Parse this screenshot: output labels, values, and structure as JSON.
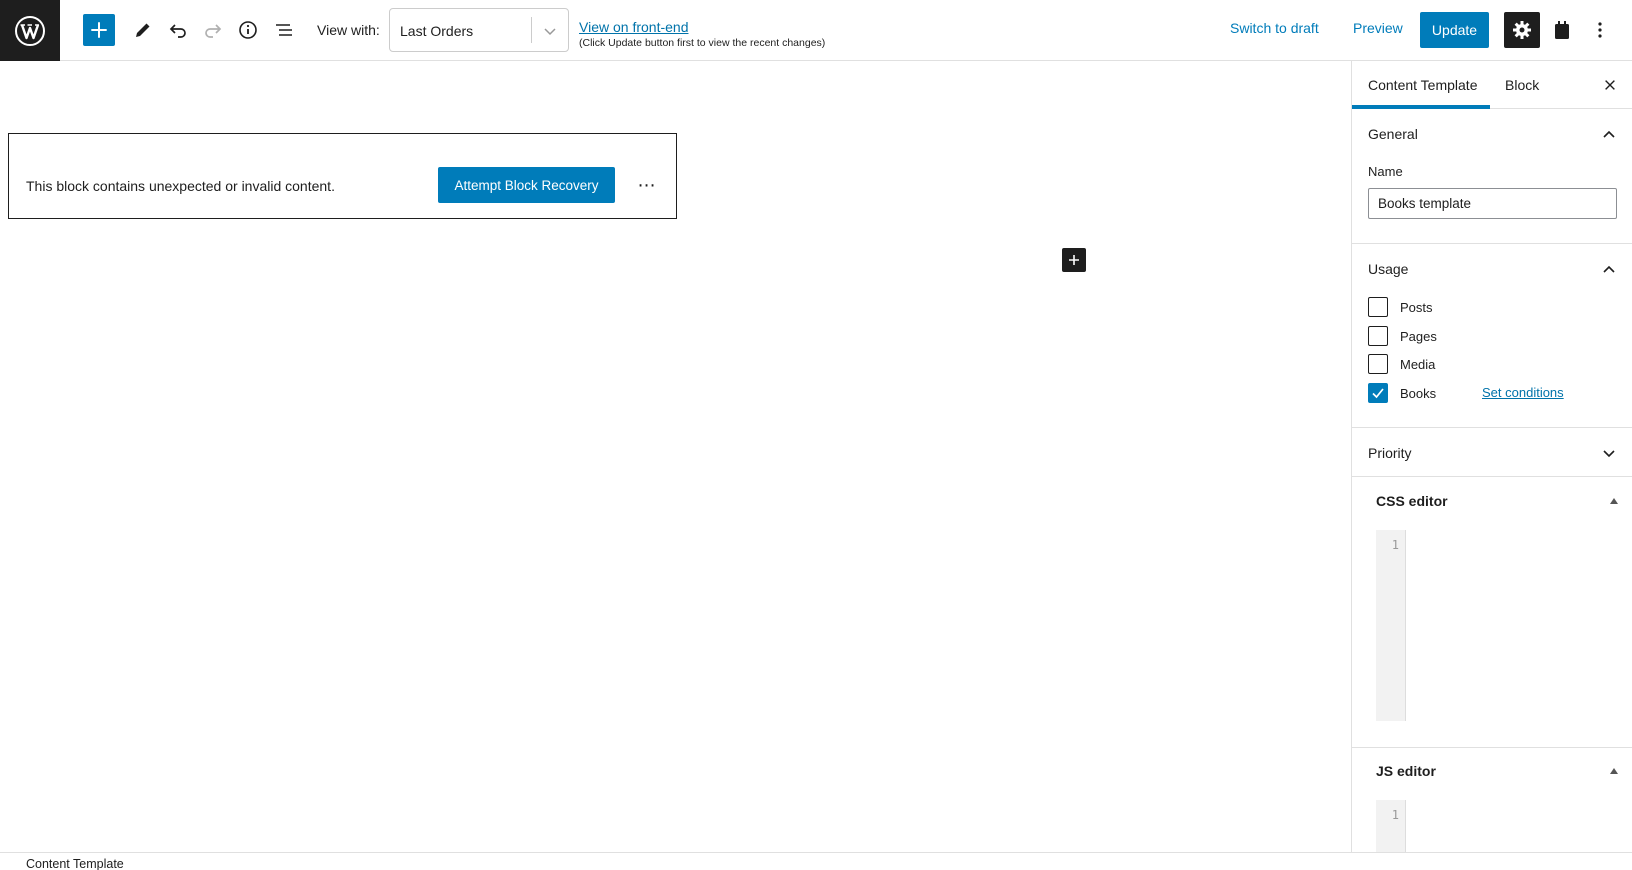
{
  "toolbar": {
    "view_with_label": "View with:",
    "view_with_value": "Last Orders",
    "frontend_link": "View on front-end",
    "frontend_note": "(Click Update button first to view the recent changes)",
    "switch_to_draft": "Switch to draft",
    "preview": "Preview",
    "update": "Update"
  },
  "editor": {
    "warning_text": "This block contains unexpected or invalid content.",
    "recovery_button": "Attempt Block Recovery",
    "more_label": "⋯"
  },
  "sidebar": {
    "tabs": [
      {
        "label": "Content Template",
        "active": true
      },
      {
        "label": "Block",
        "active": false
      }
    ],
    "general": {
      "title": "General",
      "name_label": "Name",
      "name_value": "Books template"
    },
    "usage": {
      "title": "Usage",
      "items": [
        {
          "label": "Posts",
          "checked": false
        },
        {
          "label": "Pages",
          "checked": false
        },
        {
          "label": "Media",
          "checked": false
        },
        {
          "label": "Books",
          "checked": true
        }
      ],
      "set_conditions": "Set conditions"
    },
    "priority": {
      "title": "Priority"
    },
    "css_editor": {
      "title": "CSS editor",
      "line_number": "1"
    },
    "js_editor": {
      "title": "JS editor",
      "line_number": "1"
    }
  },
  "footer": {
    "breadcrumb": "Content Template"
  },
  "colors": {
    "accent": "#007cba",
    "dark": "#1e1e1e",
    "link": "#0073aa"
  },
  "icons": [
    "wordpress-logo-icon",
    "plus-icon",
    "pencil-icon",
    "undo-icon",
    "redo-icon",
    "info-icon",
    "list-view-icon",
    "chevron-down-icon",
    "gear-icon",
    "plugin-icon",
    "more-vertical-icon",
    "close-icon",
    "chevron-up-icon",
    "caret-up-icon",
    "checkmark-icon"
  ]
}
